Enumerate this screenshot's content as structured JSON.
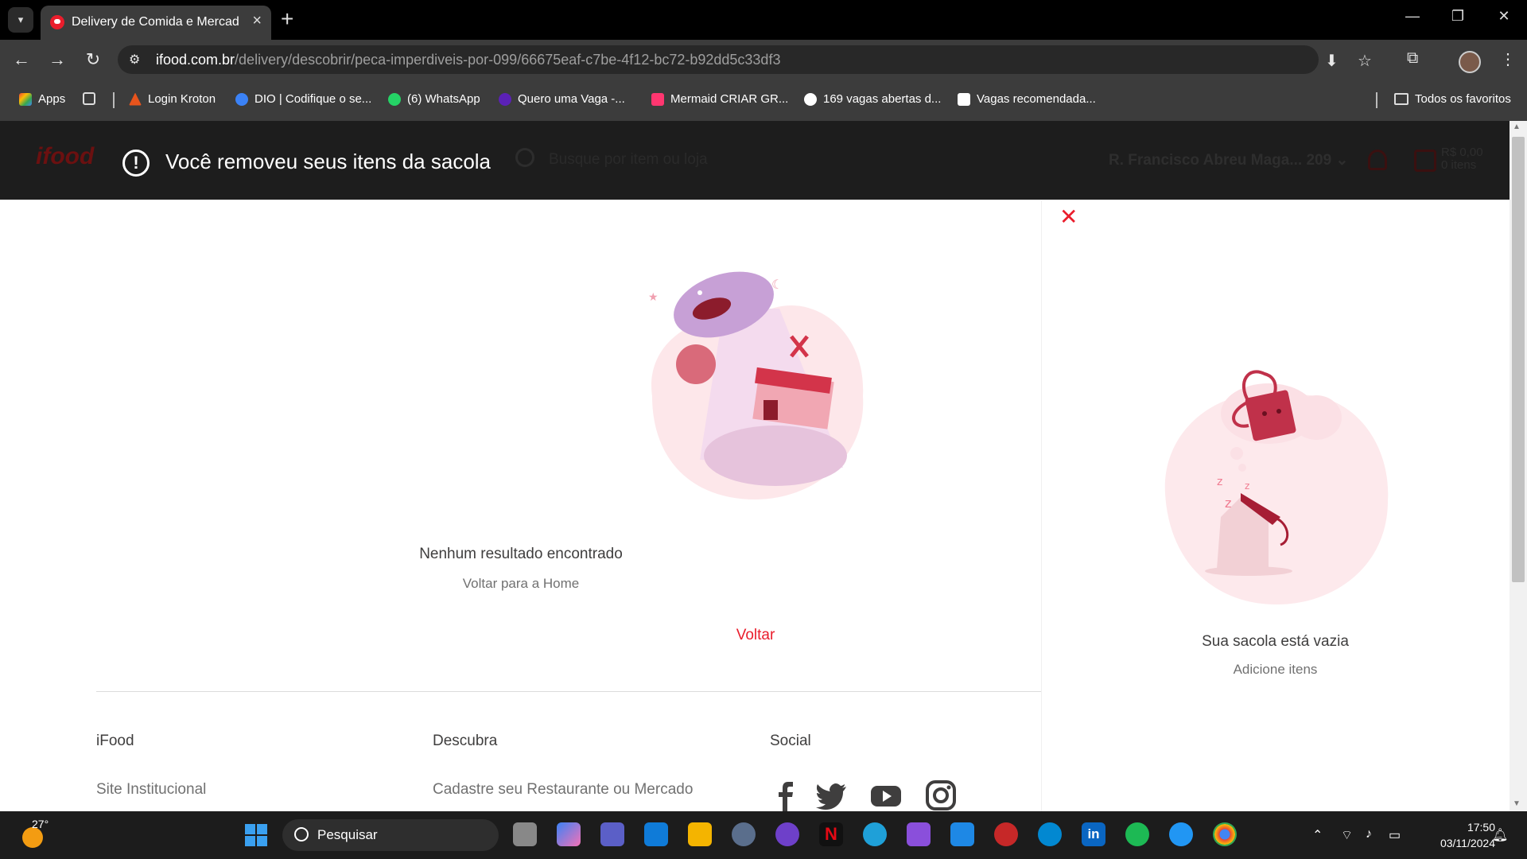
{
  "browser": {
    "tab_title": "Delivery de Comida e Mercado",
    "url_host": "ifood.com.br",
    "url_path": "/delivery/descobrir/peca-imperdiveis-por-099/66675eaf-c7be-4f12-bc72-b92dd5c33df3",
    "bookmarks": [
      {
        "label": "Apps",
        "color": "#4285f4"
      },
      {
        "label": "Login Kroton",
        "color": "#e8541c"
      },
      {
        "label": "DIO | Codifique o se...",
        "color": "#3b82f6"
      },
      {
        "label": "(6) WhatsApp",
        "color": "#25d366"
      },
      {
        "label": "Quero uma Vaga -...",
        "color": "#5b21b6"
      },
      {
        "label": "Mermaid CRIAR GR...",
        "color": "#ff3670"
      },
      {
        "label": "169 vagas abertas d...",
        "color": "#ffffff"
      },
      {
        "label": "Vagas recomendada...",
        "color": "#ffffff"
      }
    ],
    "all_bookmarks": "Todos os favoritos"
  },
  "page": {
    "logo": "ifood",
    "toast": "Você removeu seus itens da sacola",
    "search_placeholder": "Busque por item ou loja",
    "address": "R. Francisco Abreu Maga... 209",
    "bag_price": "R$ 0,00",
    "bag_items": "0 itens",
    "empty_title": "Nenhum resultado encontrado",
    "empty_sub": "Voltar para a Home",
    "back_link": "Voltar",
    "accent_color": "#ea1d2c"
  },
  "footer": {
    "cols": [
      {
        "title": "iFood",
        "link": "Site Institucional"
      },
      {
        "title": "Descubra",
        "link": "Cadastre seu Restaurante ou Mercado"
      },
      {
        "title": "Social",
        "link": ""
      }
    ],
    "social_icons": [
      "facebook-icon",
      "twitter-icon",
      "youtube-icon",
      "instagram-icon"
    ]
  },
  "drawer": {
    "title": "Sua sacola está vazia",
    "subtitle": "Adicione itens"
  },
  "taskbar": {
    "temperature": "27°",
    "search_placeholder": "Pesquisar",
    "time": "17:50",
    "date": "03/11/2024"
  }
}
